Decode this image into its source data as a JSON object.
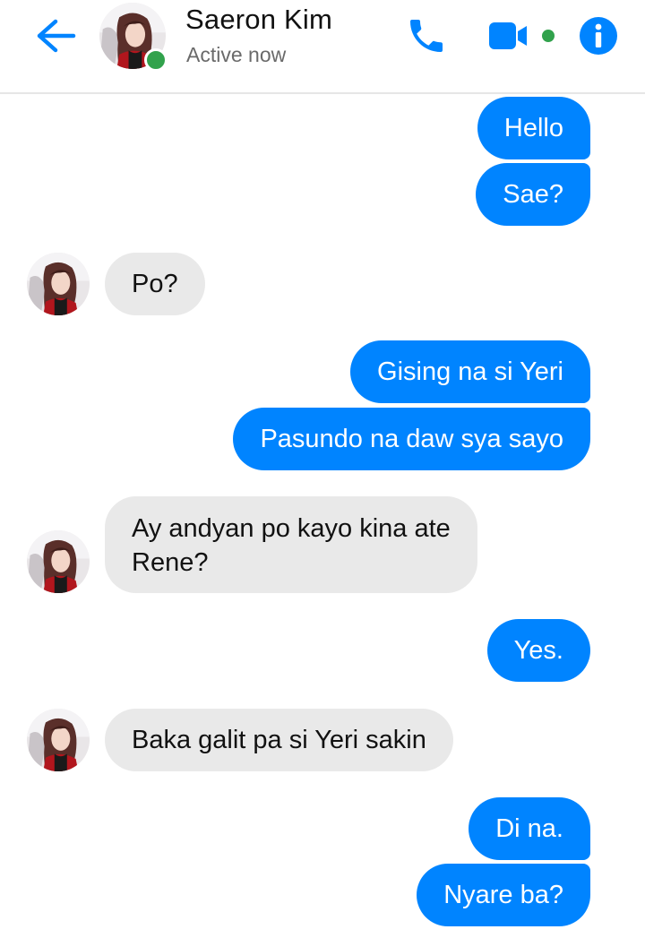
{
  "header": {
    "contact_name": "Saeron Kim",
    "status": "Active now",
    "accent_color": "#0084ff",
    "online_color": "#31a24c",
    "icons": {
      "back": "back-arrow-icon",
      "call": "phone-icon",
      "video": "video-camera-icon",
      "info": "info-icon"
    }
  },
  "messages": [
    {
      "from": "me",
      "text": "Hello"
    },
    {
      "from": "me",
      "text": "Sae?"
    },
    {
      "from": "contact",
      "text": "Po?"
    },
    {
      "from": "me",
      "text": "Gising na si Yeri"
    },
    {
      "from": "me",
      "text": "Pasundo na daw sya sayo"
    },
    {
      "from": "contact",
      "text": "Ay andyan po kayo kina ate\nRene?"
    },
    {
      "from": "me",
      "text": "Yes."
    },
    {
      "from": "contact",
      "text": "Baka galit pa si Yeri sakin"
    },
    {
      "from": "me",
      "text": "Di na."
    },
    {
      "from": "me",
      "text": "Nyare ba?"
    }
  ]
}
